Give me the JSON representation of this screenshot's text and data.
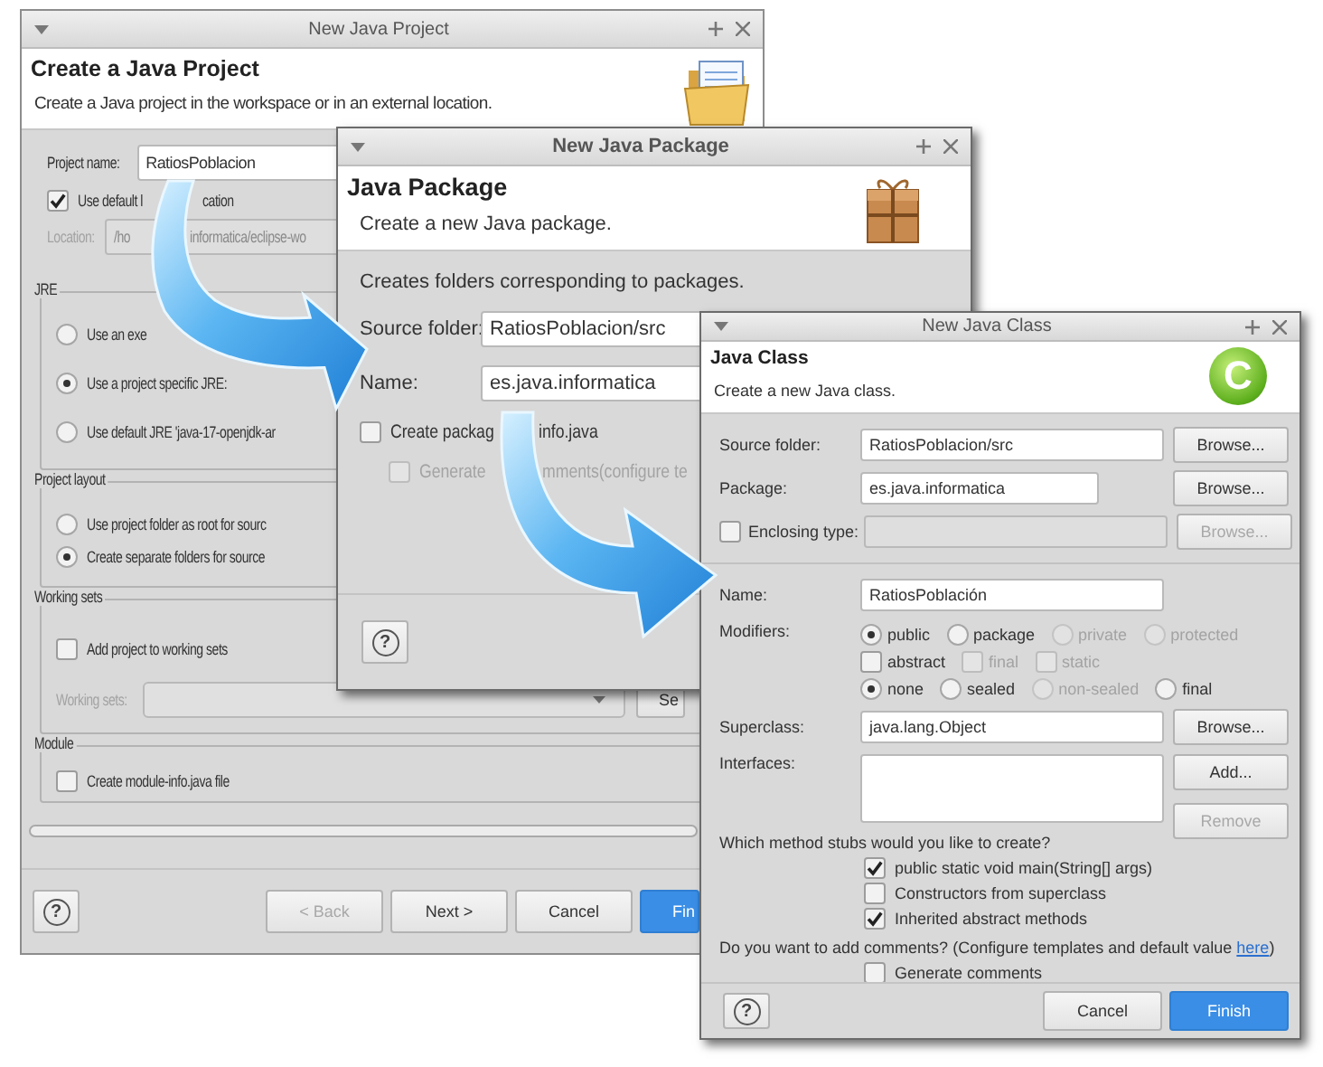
{
  "windows": [
    {
      "title": "New Java Project",
      "header": {
        "title": "Create a Java Project",
        "description": "Create a Java project in the workspace or in an external location."
      },
      "rows": [
        {
          "kind": "field",
          "label": "Project name:",
          "value": "RatiosPoblacion",
          "disabled": false
        },
        {
          "kind": "check",
          "label": "Use default l",
          "label_after": "cation",
          "checked": true
        },
        {
          "kind": "field",
          "label": "Location:",
          "value": "/ho",
          "value_after": "informatica/eclipse-wo",
          "disabled": true
        },
        {
          "kind": "group",
          "title": "JRE",
          "rows": [
            {
              "kind": "radio",
              "label": "Use an exe",
              "selected": false
            },
            {
              "kind": "radio",
              "label": "Use a project specific JRE:",
              "selected": true
            },
            {
              "kind": "radio",
              "label": "Use default JRE 'java-17-openjdk-ar",
              "selected": false
            }
          ]
        },
        {
          "kind": "group",
          "title": "Project layout",
          "rows": [
            {
              "kind": "radio",
              "label": "Use project folder as root for sourc",
              "selected": false
            },
            {
              "kind": "radio",
              "label": "Create separate folders for source",
              "selected": true
            }
          ]
        },
        {
          "kind": "group",
          "title": "Working sets",
          "rows": [
            {
              "kind": "check",
              "label": "Add project to working sets",
              "checked": false
            },
            {
              "kind": "combo",
              "label": "Working sets:",
              "disabled": true,
              "button": {
                "label": "Se",
                "disabled": false
              }
            }
          ]
        },
        {
          "kind": "group",
          "title": "Module",
          "rows": [
            {
              "kind": "check",
              "label": "Create module-info.java file",
              "checked": false
            }
          ]
        },
        {
          "kind": "progress",
          "level": 0
        }
      ],
      "buttons": [
        {
          "kind": "help",
          "label": "?",
          "disabled": false
        },
        {
          "kind": "push",
          "label": "< Back",
          "disabled": true
        },
        {
          "kind": "push",
          "label": "Next >",
          "disabled": false
        },
        {
          "kind": "push",
          "label": "Cancel",
          "disabled": false
        },
        {
          "kind": "default",
          "label": "Fin",
          "disabled": false
        }
      ]
    },
    {
      "title": "New Java Package",
      "header": {
        "title": "Java Package",
        "description": "Create a new Java package."
      },
      "rows": [
        {
          "kind": "text",
          "parts": [
            {
              "text": "Creates folders corresponding to packages."
            }
          ]
        },
        {
          "kind": "field",
          "label": "Source folder:",
          "value": "RatiosPoblacion/src",
          "disabled": false
        },
        {
          "kind": "field",
          "label": "Name:",
          "value": "es.java.informatica",
          "disabled": false
        },
        {
          "kind": "check",
          "label": "Create packag",
          "label_after": "info.java",
          "checked": false
        },
        {
          "kind": "indent",
          "rows": [
            {
              "kind": "check",
              "label": "Generate",
              "label_after": "mments(configure te",
              "checked": false,
              "disabled": true
            }
          ]
        }
      ],
      "buttons": [
        {
          "kind": "help",
          "label": "?",
          "disabled": false
        }
      ]
    },
    {
      "title": "New Java Class",
      "header": {
        "title": "Java Class",
        "description": "Create a new Java class.",
        "badge": "C"
      },
      "rows": [
        {
          "kind": "field",
          "label": "Source folder:",
          "value": "RatiosPoblacion/src",
          "disabled": false,
          "button": {
            "label": "Browse...",
            "disabled": false
          }
        },
        {
          "kind": "field",
          "label": "Package:",
          "value": "es.java.informatica",
          "disabled": false,
          "button": {
            "label": "Browse...",
            "disabled": false
          }
        },
        {
          "kind": "field",
          "label": "Enclosing type:",
          "check": {
            "checked": false
          },
          "disabled": true,
          "button": {
            "label": "Browse...",
            "disabled": true
          }
        },
        {
          "kind": "separator"
        },
        {
          "kind": "field",
          "label": "Name:",
          "value": "RatiosPoblación",
          "disabled": false
        },
        {
          "kind": "options",
          "label": "Modifiers:",
          "lines": [
            [
              {
                "kind": "radio",
                "label": "public",
                "selected": true,
                "disabled": false
              },
              {
                "kind": "radio",
                "label": "package",
                "selected": false,
                "disabled": false
              },
              {
                "kind": "radio",
                "label": "private",
                "selected": false,
                "disabled": true
              },
              {
                "kind": "radio",
                "label": "protected",
                "selected": false,
                "disabled": true
              }
            ],
            [
              {
                "kind": "check",
                "label": "abstract",
                "checked": false,
                "disabled": false
              },
              {
                "kind": "check",
                "label": "final",
                "checked": false,
                "disabled": true
              },
              {
                "kind": "check",
                "label": "static",
                "checked": false,
                "disabled": true
              }
            ],
            [
              {
                "kind": "radio",
                "label": "none",
                "selected": true,
                "disabled": false
              },
              {
                "kind": "radio",
                "label": "sealed",
                "selected": false,
                "disabled": false
              },
              {
                "kind": "radio",
                "label": "non-sealed",
                "selected": false,
                "disabled": true
              },
              {
                "kind": "radio",
                "label": "final",
                "selected": false,
                "disabled": false
              }
            ]
          ]
        },
        {
          "kind": "field",
          "label": "Superclass:",
          "value": "java.lang.Object",
          "disabled": false,
          "button": {
            "label": "Browse...",
            "disabled": false
          }
        },
        {
          "kind": "list",
          "label": "Interfaces:",
          "buttons": [
            {
              "label": "Add...",
              "disabled": false
            },
            {
              "label": "Remove",
              "disabled": true
            }
          ]
        },
        {
          "kind": "text",
          "parts": [
            {
              "text": "Which method stubs would you like to create?"
            }
          ]
        },
        {
          "kind": "indent",
          "rows": [
            {
              "kind": "check",
              "label": "public static void main(String[] args)",
              "checked": true
            },
            {
              "kind": "check",
              "label": "Constructors from superclass",
              "checked": false
            },
            {
              "kind": "check",
              "label": "Inherited abstract methods",
              "checked": true
            }
          ]
        },
        {
          "kind": "text",
          "parts": [
            {
              "text": "Do you want to add comments? (Configure templates and default value "
            },
            {
              "text": "here",
              "link": true
            },
            {
              "text": ")"
            }
          ]
        },
        {
          "kind": "indent",
          "rows": [
            {
              "kind": "check",
              "label": "Generate comments",
              "checked": false
            }
          ]
        }
      ],
      "buttons": [
        {
          "kind": "help",
          "label": "?",
          "disabled": false
        },
        {
          "kind": "push",
          "label": "Cancel",
          "disabled": false
        },
        {
          "kind": "default",
          "label": "Finish",
          "disabled": false
        }
      ]
    }
  ]
}
